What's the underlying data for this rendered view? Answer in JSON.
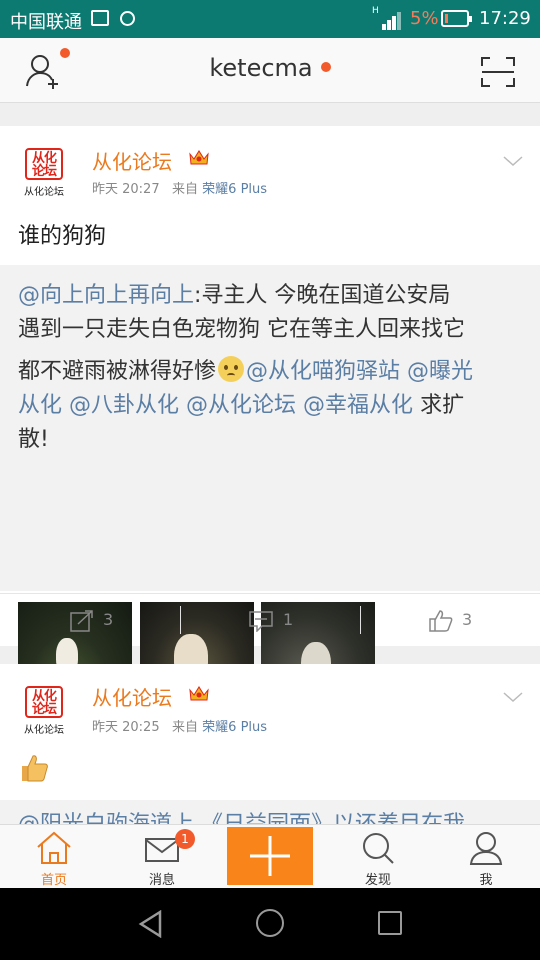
{
  "status_bar": {
    "carrier": "中国联通",
    "battery_percent": "5%",
    "time": "17:29",
    "network": "H"
  },
  "top_nav": {
    "username": "ketecma"
  },
  "posts": [
    {
      "author": "从化论坛",
      "avatar_seal_text": "从化论坛",
      "avatar_caption": "从化论坛",
      "time": "昨天 20:27",
      "source_prefix": "来自",
      "source": "荣耀6 Plus",
      "text": "谁的狗狗",
      "repost": {
        "mention": "@向上向上再向上",
        "line1": ":寻主人 今晚在国道公安局",
        "line2": "遇到一只走失白色宠物狗 它在等主人回来找它",
        "line3": "都不避雨被淋得好惨",
        "mention2": "@从化喵狗驿站",
        "mention3": "@曝光",
        "line4_mention": "从化",
        "mention4": "@八卦从化",
        "mention5": "@从化论坛",
        "mention6": "@幸福从化",
        "line4_tail": "求扩",
        "line5": "散!"
      },
      "photos": [
        "dog-photo-1",
        "dog-photo-2",
        "dog-photo-3"
      ],
      "reposts": "3",
      "comments": "1",
      "likes": "3"
    },
    {
      "author": "从化论坛",
      "avatar_seal_text": "从化论坛",
      "avatar_caption": "从化论坛",
      "time": "昨天 20:25",
      "source_prefix": "来自",
      "source": "荣耀6 Plus",
      "emoji": "thumbs-up",
      "peek_text": "@阳光白驹海道上 《日益园面》以还养目在我"
    }
  ],
  "tab_bar": {
    "tabs": [
      {
        "label": "首页",
        "icon": "home-icon",
        "active": true
      },
      {
        "label": "消息",
        "icon": "mail-icon",
        "badge": "1"
      },
      {
        "label": "发现",
        "icon": "search-icon"
      },
      {
        "label": "我",
        "icon": "profile-icon"
      }
    ],
    "compose_icon": "plus-icon"
  },
  "colors": {
    "status_bar": "#0d7a72",
    "accent": "#eb7a1e",
    "compose": "#f98419",
    "link": "#5b7ea5",
    "badge": "#f25a2b"
  }
}
